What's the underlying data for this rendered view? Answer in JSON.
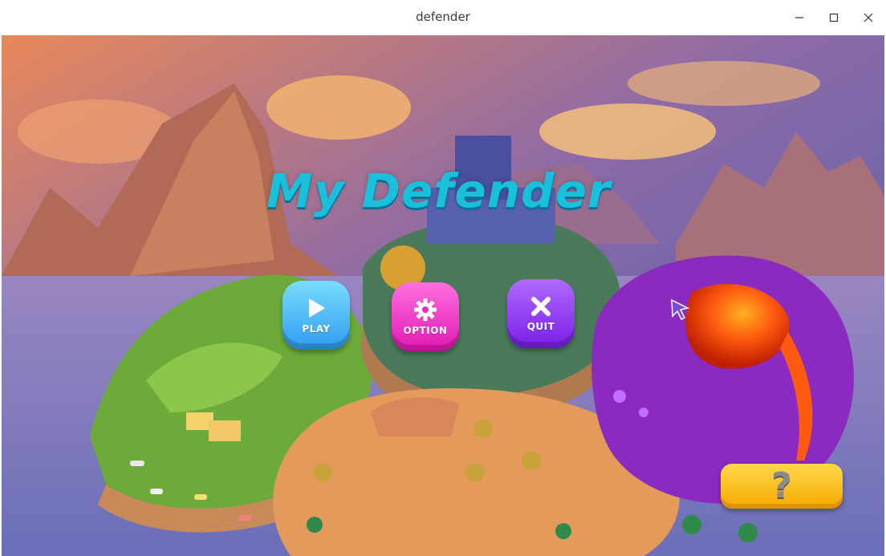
{
  "window": {
    "title": "defender",
    "controls": [
      "minimize",
      "maximize",
      "close"
    ]
  },
  "game": {
    "logo": "My Defender",
    "menu": [
      {
        "label": "PLAY",
        "icon": "play-icon",
        "color": "#3fa9f5"
      },
      {
        "label": "OPTION",
        "icon": "gear-icon",
        "color": "#f03cc8"
      },
      {
        "label": "QUIT",
        "icon": "close-x-icon",
        "color": "#8b2cf0"
      }
    ],
    "help": {
      "symbol": "?",
      "icon": "question-icon",
      "color": "#ffc21a"
    }
  }
}
